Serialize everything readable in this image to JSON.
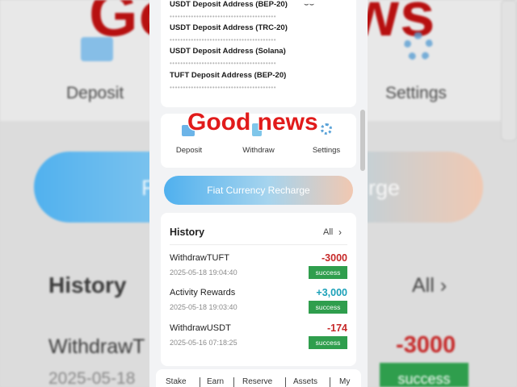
{
  "background": {
    "headline": "Good news",
    "labels": [
      "Deposit",
      "Settings"
    ],
    "button_left": "F",
    "button_right": "rge",
    "history_title": "History",
    "all_label": "All",
    "withdraw_label": "WithdrawT",
    "amount": "-3000",
    "date": "2025-05-18",
    "badge": "success"
  },
  "deposit_addresses": [
    {
      "label": "USDT Deposit Address (BEP-20)",
      "dots": "••••••••••••••••••••••••••••••••••••••••"
    },
    {
      "label": "USDT Deposit Address (TRC-20)",
      "dots": "••••••••••••••••••••••••••••••••••••••••"
    },
    {
      "label": "USDT Deposit Address (Solana)",
      "dots": "••••••••••••••••••••••••••••••••••••••••"
    },
    {
      "label": "TUFT Deposit Address (BEP-20)",
      "dots": "••••••••••••••••••••••••••••••••••••••••"
    }
  ],
  "headline": "Good news",
  "quick_actions": {
    "deposit": "Deposit",
    "withdraw": "Withdraw",
    "settings": "Settings"
  },
  "fiat_button": "Fiat Currency Recharge",
  "history": {
    "title": "History",
    "all": "All",
    "items": [
      {
        "name": "WithdrawTUFT",
        "date": "2025-05-18 19:04:40",
        "amount": "-3000",
        "status": "success",
        "color": "#c62727"
      },
      {
        "name": "Activity Rewards",
        "date": "2025-05-18 19:03:40",
        "amount": "+3,000",
        "status": "success",
        "color": "#1aa0b8"
      },
      {
        "name": "WithdrawUSDT",
        "date": "2025-05-16 07:18:25",
        "amount": "-174",
        "status": "success",
        "color": "#c62727"
      }
    ]
  },
  "bottom_nav": [
    "Stake",
    "Earn",
    "Reserve",
    "Assets",
    "My"
  ],
  "colors": {
    "accent": "#4fb0ee",
    "success": "#2f9e4d",
    "negative": "#c62727",
    "positive": "#1aa0b8"
  }
}
